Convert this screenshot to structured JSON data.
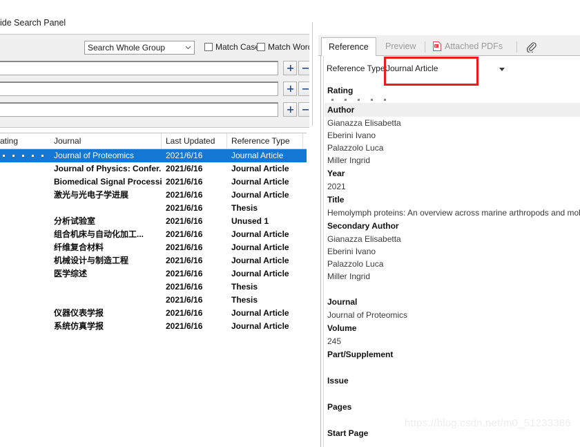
{
  "left": {
    "hide_search_panel_label": "ide Search Panel",
    "search": {
      "scope_value": "Search Whole Group",
      "match_case_label": "Match Case",
      "match_words_label": "Match Words",
      "rows": [
        {
          "value": "",
          "add_label": "+",
          "remove_label": "-"
        },
        {
          "value": "",
          "add_label": "+",
          "remove_label": "-"
        },
        {
          "value": "",
          "add_label": "+",
          "remove_label": "-"
        }
      ]
    },
    "table": {
      "columns": [
        "ating",
        "Journal",
        "Last Updated",
        "Reference Type"
      ],
      "rows": [
        {
          "rating": 5,
          "journal": "Journal of Proteomics",
          "updated": "2021/6/16",
          "type": "Journal Article",
          "selected": true
        },
        {
          "rating": 0,
          "journal": "Journal of Physics: Confer...",
          "updated": "2021/6/16",
          "type": "Journal Article",
          "selected": false
        },
        {
          "rating": 0,
          "journal": "Biomedical Signal Processi...",
          "updated": "2021/6/16",
          "type": "Journal Article",
          "selected": false
        },
        {
          "rating": 0,
          "journal": "激光与光电子学进展",
          "updated": "2021/6/16",
          "type": "Journal Article",
          "selected": false
        },
        {
          "rating": 0,
          "journal": "",
          "updated": "2021/6/16",
          "type": "Thesis",
          "selected": false
        },
        {
          "rating": 0,
          "journal": "分析试验室",
          "updated": "2021/6/16",
          "type": "Unused 1",
          "selected": false
        },
        {
          "rating": 0,
          "journal": "组合机床与自动化加工...",
          "updated": "2021/6/16",
          "type": "Journal Article",
          "selected": false
        },
        {
          "rating": 0,
          "journal": "纤维复合材料",
          "updated": "2021/6/16",
          "type": "Journal Article",
          "selected": false
        },
        {
          "rating": 0,
          "journal": "机械设计与制造工程",
          "updated": "2021/6/16",
          "type": "Journal Article",
          "selected": false
        },
        {
          "rating": 0,
          "journal": "医学综述",
          "updated": "2021/6/16",
          "type": "Journal Article",
          "selected": false
        },
        {
          "rating": 0,
          "journal": "",
          "updated": "2021/6/16",
          "type": "Thesis",
          "selected": false
        },
        {
          "rating": 0,
          "journal": "",
          "updated": "2021/6/16",
          "type": "Thesis",
          "selected": false
        },
        {
          "rating": 0,
          "journal": "仪器仪表学报",
          "updated": "2021/6/16",
          "type": "Journal Article",
          "selected": false
        },
        {
          "rating": 0,
          "journal": "系统仿真学报",
          "updated": "2021/6/16",
          "type": "Journal Article",
          "selected": false
        }
      ]
    }
  },
  "right": {
    "tabs": [
      {
        "label": "Reference",
        "active": true,
        "icon": ""
      },
      {
        "label": "Preview",
        "active": false,
        "icon": ""
      },
      {
        "label": "Attached PDFs",
        "active": false,
        "icon": "pdf-icon"
      },
      {
        "label": "",
        "active": false,
        "icon": "paperclip-icon"
      }
    ],
    "reference_type": {
      "label": "Reference Type:",
      "value": "Journal Article",
      "dropdown_icon": "caret-down-icon",
      "highlight_color": "#ee1b1b"
    },
    "fields": [
      {
        "name": "Rating",
        "type": "rating",
        "stars": 5
      },
      {
        "name": "Author",
        "type": "text",
        "shaded": true,
        "values": [
          "Gianazza Elisabetta",
          "Eberini Ivano",
          "Palazzolo Luca",
          "Miller Ingrid"
        ]
      },
      {
        "name": "Year",
        "type": "text",
        "shaded": false,
        "values": [
          "2021"
        ]
      },
      {
        "name": "Title",
        "type": "text",
        "shaded": false,
        "values": [
          "Hemolymph proteins: An overview across marine arthropods and mollu"
        ]
      },
      {
        "name": "Secondary Author",
        "type": "text",
        "shaded": false,
        "values": [
          "Gianazza Elisabetta",
          "Eberini Ivano",
          "Palazzolo Luca",
          "Miller Ingrid",
          ""
        ]
      },
      {
        "name": "Journal",
        "type": "text",
        "shaded": false,
        "values": [
          "Journal of Proteomics"
        ]
      },
      {
        "name": "Volume",
        "type": "text",
        "shaded": false,
        "values": [
          "245"
        ]
      },
      {
        "name": "Part/Supplement",
        "type": "text",
        "shaded": false,
        "values": [
          ""
        ]
      },
      {
        "name": "Issue",
        "type": "text",
        "shaded": false,
        "values": [
          ""
        ]
      },
      {
        "name": "Pages",
        "type": "text",
        "shaded": false,
        "values": [
          ""
        ]
      },
      {
        "name": "Start Page",
        "type": "text",
        "shaded": false,
        "values": []
      }
    ]
  },
  "watermark": "https://blog.csdn.net/m0_51233386",
  "colors": {
    "selection_blue": "#1477d4",
    "highlight_red": "#ee1b1b",
    "panel_gray": "#f0f0f0"
  }
}
